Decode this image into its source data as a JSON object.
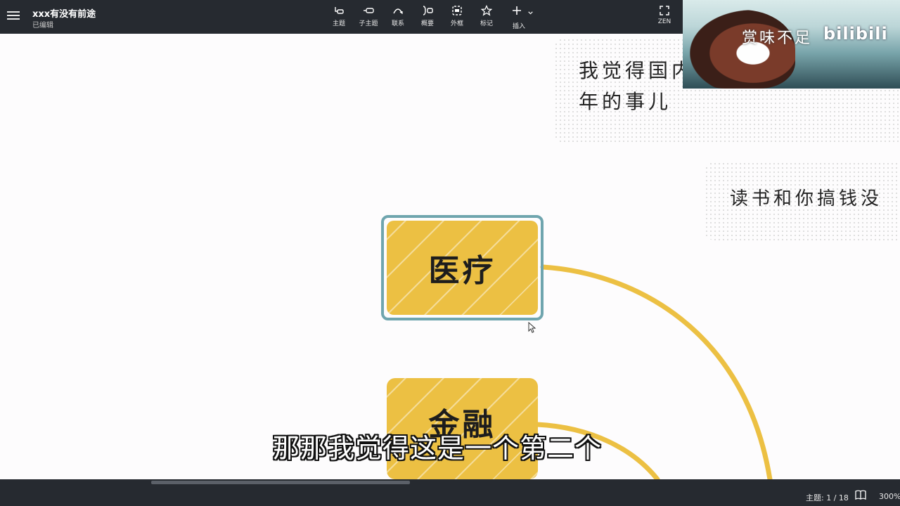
{
  "header": {
    "title": "xxx有没有前途",
    "status": "已编辑",
    "tools": [
      {
        "label": "主题",
        "icon": "topic-icon"
      },
      {
        "label": "子主题",
        "icon": "subtopic-icon"
      },
      {
        "label": "联系",
        "icon": "relationship-icon"
      },
      {
        "label": "概要",
        "icon": "summary-icon"
      },
      {
        "label": "外框",
        "icon": "boundary-icon"
      },
      {
        "label": "标记",
        "icon": "star-icon"
      },
      {
        "label": "插入",
        "icon": "plus-icon"
      }
    ],
    "zen_label": "ZEN"
  },
  "canvas": {
    "notes": [
      {
        "line1": "我觉得国内",
        "line2": "年的事儿"
      },
      {
        "line1": "读书和你搞钱没"
      }
    ],
    "nodes": {
      "selected": "医疗",
      "second": "金融"
    },
    "connector_color": "#ecc043",
    "frame_color": "#6fa5ae"
  },
  "overlay": {
    "webcam_signature": "赏味不足",
    "webcam_logo": "bilibili",
    "subtitle": "那那我觉得这是一个第二个"
  },
  "statusbar": {
    "topic_count": "主题: 1 / 18",
    "zoom": "300%"
  }
}
